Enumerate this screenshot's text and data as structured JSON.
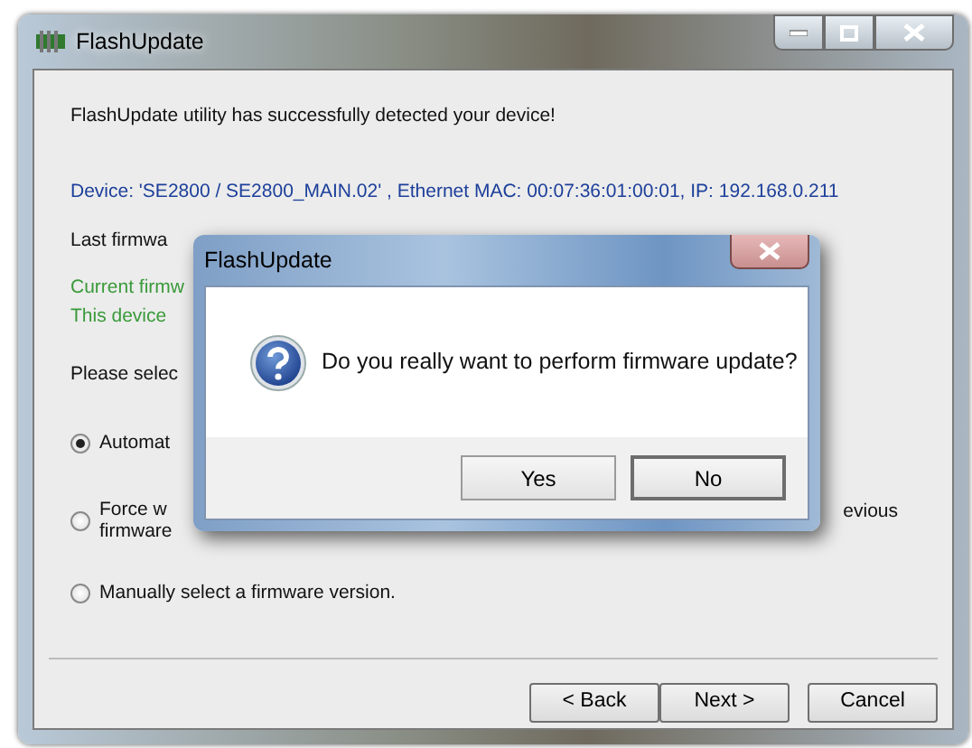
{
  "window": {
    "title": "FlashUpdate"
  },
  "intro": "FlashUpdate utility has successfully detected your device!",
  "device_info": "Device: 'SE2800 / SE2800_MAIN.02' , Ethernet MAC: 00:07:36:01:00:01, IP: 192.168.0.211",
  "last_update": "Last firmwa",
  "current_firmware": "Current firmw",
  "device_status": "This device",
  "prompt": "Please selec",
  "options": [
    {
      "lines": [
        "Automat"
      ],
      "selected": true
    },
    {
      "lines": [
        "Force w",
        "firmware"
      ],
      "right_text": "evious",
      "selected": false
    },
    {
      "lines": [
        "Manually select a firmware version."
      ],
      "selected": false
    }
  ],
  "buttons": [
    {
      "label": "< Back"
    },
    {
      "label": "Next >"
    },
    {
      "label": "Cancel"
    }
  ],
  "dialog": {
    "title": "FlashUpdate",
    "message": "Do you really want to perform firmware update?",
    "buttons": [
      {
        "label": "Yes",
        "focused": false
      },
      {
        "label": "No",
        "focused": true
      }
    ]
  }
}
